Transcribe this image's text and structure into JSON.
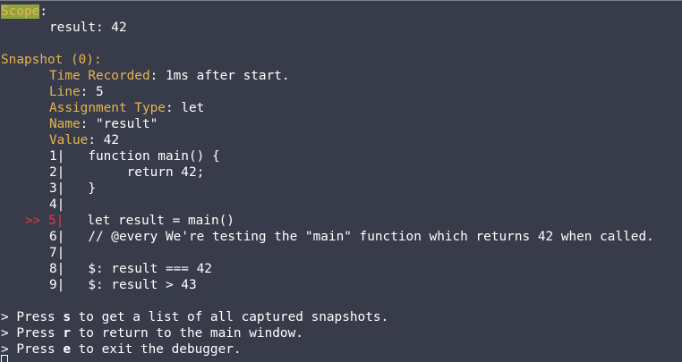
{
  "scope": {
    "label": "Scope",
    "colon": ":",
    "result_line": "result: 42"
  },
  "snapshot": {
    "header": "Snapshot (0):",
    "time_label": "Time Recorded",
    "time_value": ": 1ms after start.",
    "line_label": "Line",
    "line_value": ": 5",
    "assign_label": "Assignment Type",
    "assign_value": ": let",
    "name_label": "Name",
    "name_value": ": \"result\"",
    "value_label": "Value",
    "value_value": ": 42"
  },
  "code": {
    "marker": ">> ",
    "lines": [
      {
        "num": "1|",
        "text": "   function main() {"
      },
      {
        "num": "2|",
        "text": "        return 42;"
      },
      {
        "num": "3|",
        "text": "   }"
      },
      {
        "num": "4|",
        "text": ""
      },
      {
        "num": "5|",
        "text": "   let result = main()"
      },
      {
        "num": "6|",
        "text": "   // @every We're testing the \"main\" function which returns 42 when called."
      },
      {
        "num": "7|",
        "text": ""
      },
      {
        "num": "8|",
        "text": "   $: result === 42"
      },
      {
        "num": "9|",
        "text": "   $: result > 43"
      }
    ]
  },
  "help": [
    {
      "prefix": "> Press ",
      "key": "s",
      "suffix": " to get a list of all captured snapshots."
    },
    {
      "prefix": "> Press ",
      "key": "r",
      "suffix": " to return to the main window."
    },
    {
      "prefix": "> Press ",
      "key": "e",
      "suffix": " to exit the debugger."
    }
  ]
}
